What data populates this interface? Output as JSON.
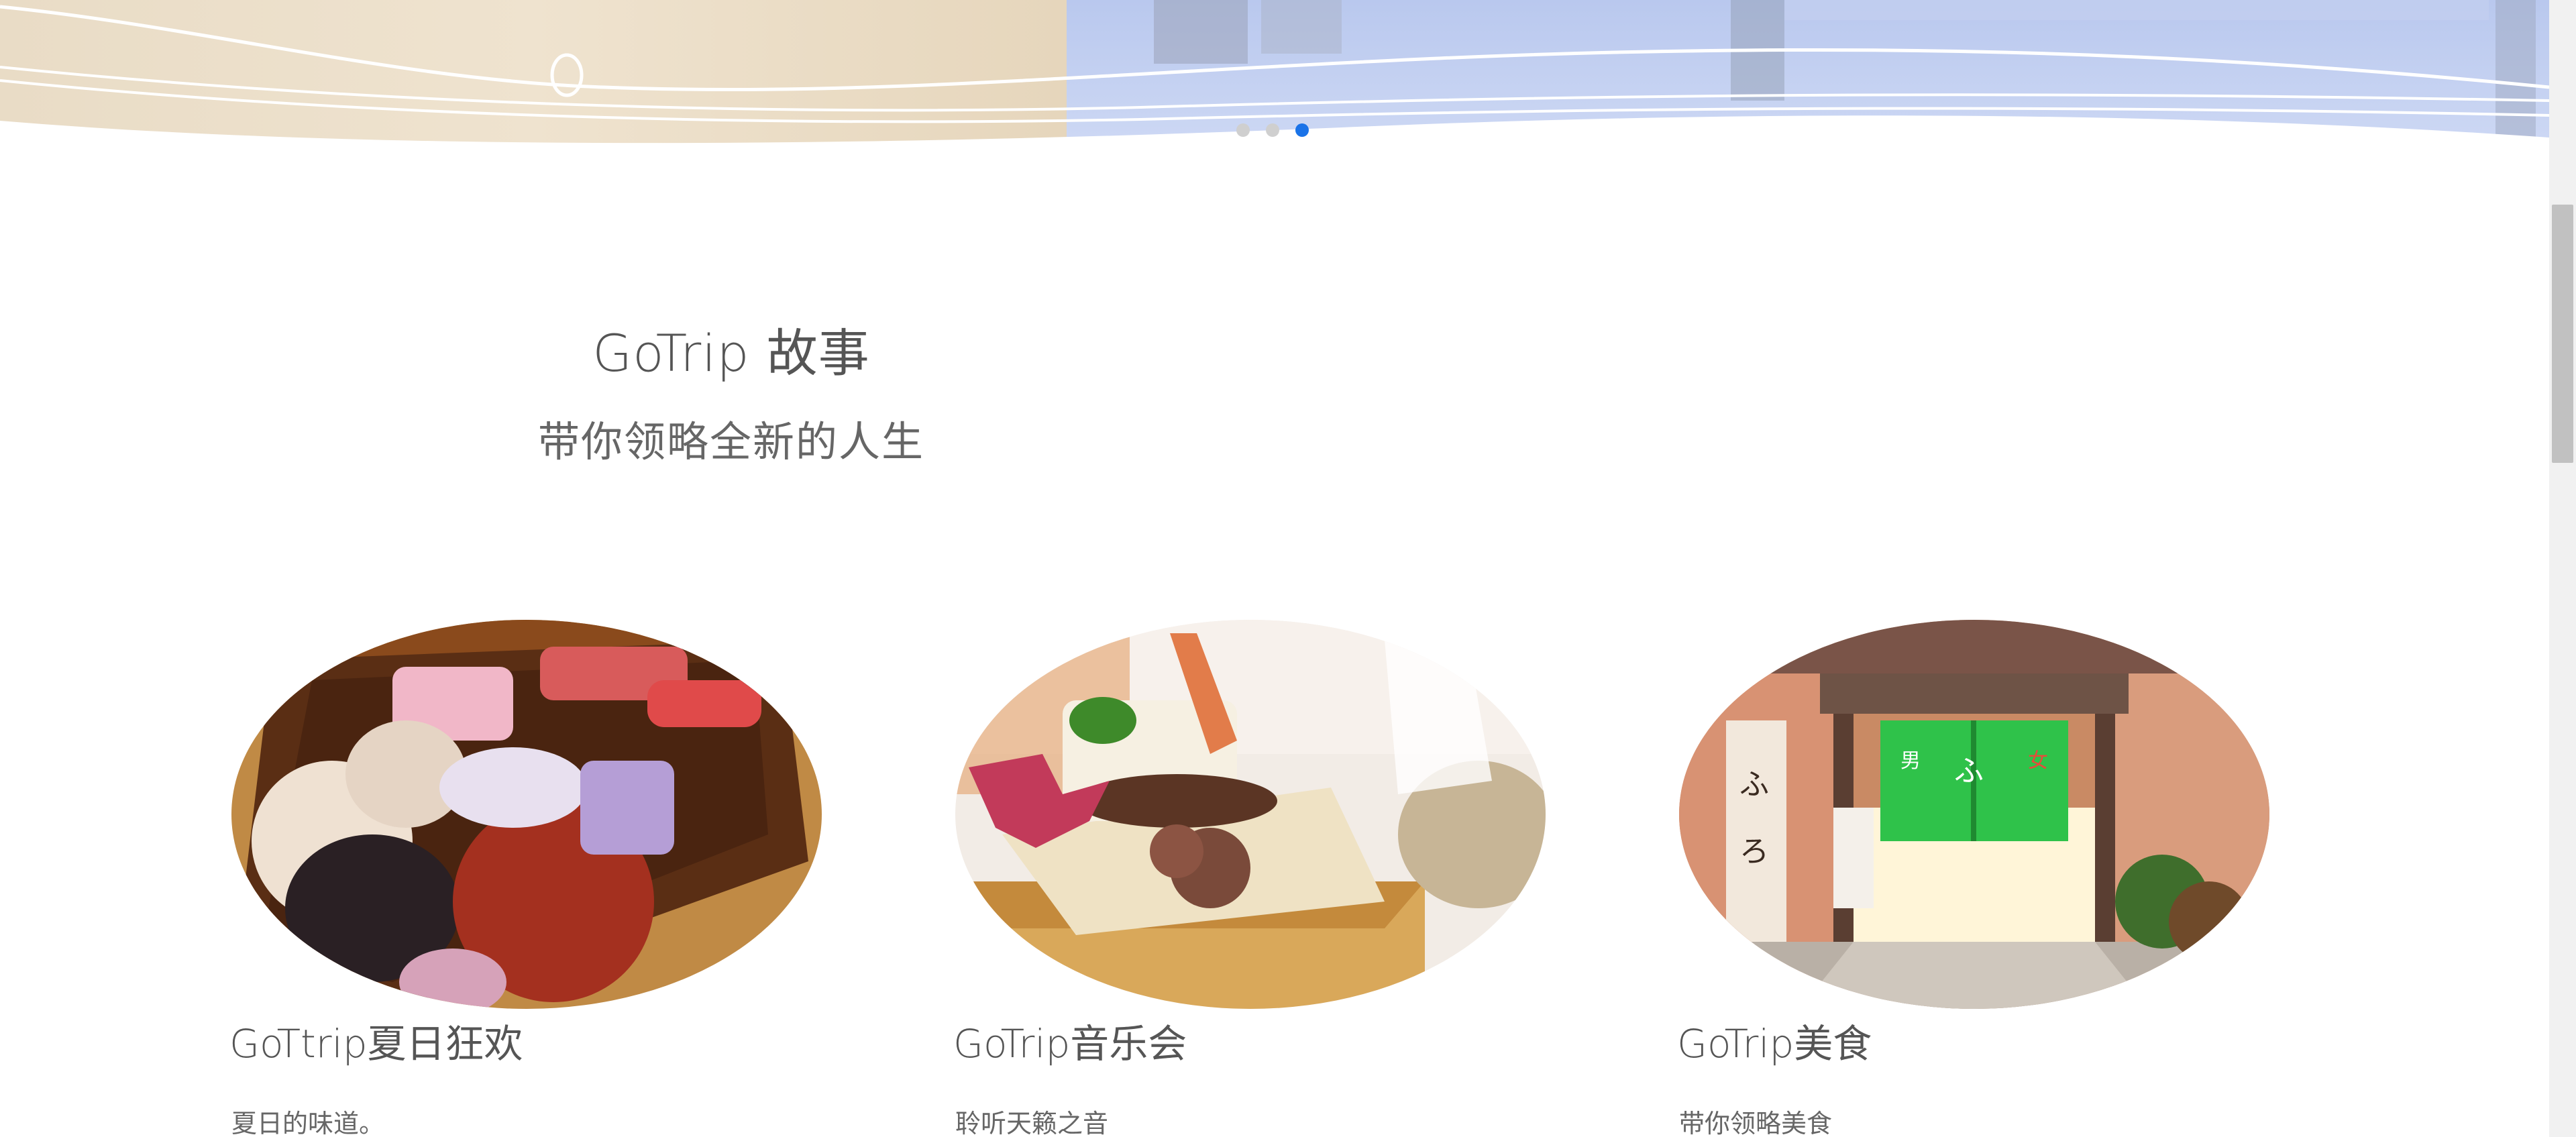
{
  "carousel": {
    "slide_count": 3,
    "active_index": 2
  },
  "story": {
    "title": "GoTrip 故事",
    "subtitle": "带你领略全新的人生"
  },
  "cards": [
    {
      "title": "GoTtrip夏日狂欢",
      "description": "夏日的味道。",
      "image": "summer-festival-photo"
    },
    {
      "title": "GoTrip音乐会",
      "description": "聆听天籁之音",
      "image": "concert-food-photo"
    },
    {
      "title": "GoTrip美食",
      "description": "带你领略美食",
      "image": "onsen-entrance-photo"
    }
  ],
  "colors": {
    "accent": "#1a73e8",
    "inactive_dot": "#cfcfcf",
    "heading_text": "#555555",
    "body_text": "#666666"
  }
}
